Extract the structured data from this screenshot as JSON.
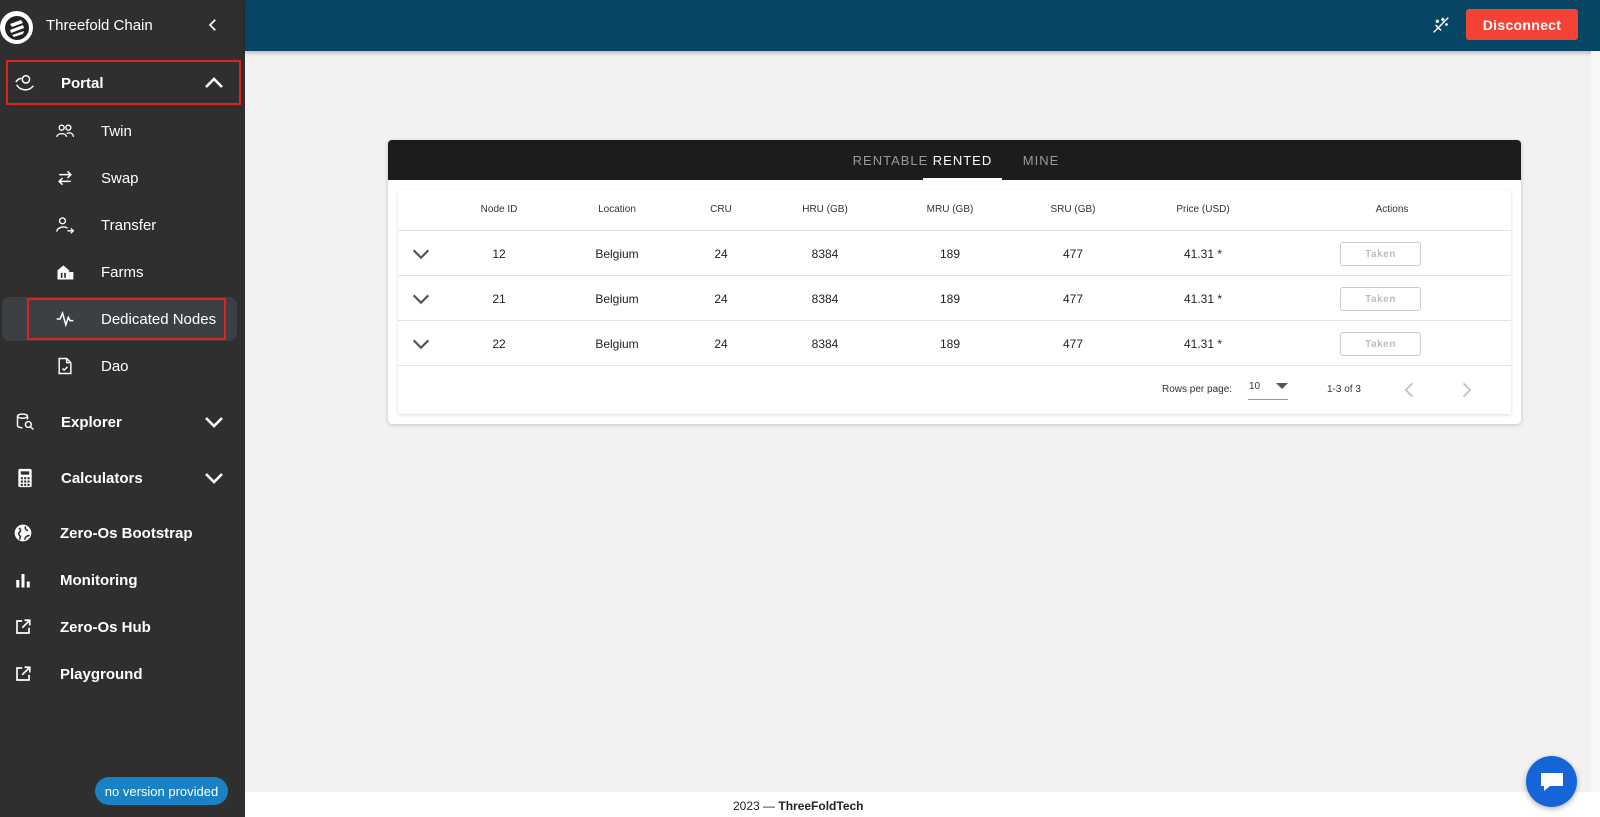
{
  "brand": {
    "title": "Threefold Chain"
  },
  "sidebar": {
    "portal": {
      "label": "Portal"
    },
    "portal_items": [
      {
        "label": "Twin",
        "icon": "twin-icon"
      },
      {
        "label": "Swap",
        "icon": "swap-icon"
      },
      {
        "label": "Transfer",
        "icon": "transfer-icon"
      },
      {
        "label": "Farms",
        "icon": "farms-icon"
      },
      {
        "label": "Dedicated Nodes",
        "icon": "dedicated-nodes-icon"
      },
      {
        "label": "Dao",
        "icon": "dao-icon"
      }
    ],
    "groups": [
      {
        "label": "Explorer",
        "icon": "explorer-icon"
      },
      {
        "label": "Calculators",
        "icon": "calculator-icon"
      }
    ],
    "links": [
      {
        "label": "Zero-Os Bootstrap",
        "icon": "globe-icon"
      },
      {
        "label": "Monitoring",
        "icon": "bar-chart-icon"
      },
      {
        "label": "Zero-Os Hub",
        "icon": "external-link-icon"
      },
      {
        "label": "Playground",
        "icon": "external-link-icon"
      }
    ],
    "version": "no version provided"
  },
  "header": {
    "disconnect_label": "Disconnect"
  },
  "tabs": [
    {
      "label": "RENTABLE",
      "active": false
    },
    {
      "label": "RENTED",
      "active": true
    },
    {
      "label": "MINE",
      "active": false
    }
  ],
  "table": {
    "headers": [
      "Node ID",
      "Location",
      "CRU",
      "HRU (GB)",
      "MRU (GB)",
      "SRU (GB)",
      "Price (USD)",
      "Actions"
    ],
    "rows": [
      {
        "node_id": "12",
        "location": "Belgium",
        "cru": "24",
        "hru": "8384",
        "mru": "189",
        "sru": "477",
        "price": "41.31 *",
        "action": "Taken"
      },
      {
        "node_id": "21",
        "location": "Belgium",
        "cru": "24",
        "hru": "8384",
        "mru": "189",
        "sru": "477",
        "price": "41.31 *",
        "action": "Taken"
      },
      {
        "node_id": "22",
        "location": "Belgium",
        "cru": "24",
        "hru": "8384",
        "mru": "189",
        "sru": "477",
        "price": "41.31 *",
        "action": "Taken"
      }
    ],
    "rows_per_page_label": "Rows per page:",
    "rows_per_page_value": "10",
    "page_info": "1-3 of 3"
  },
  "footer": {
    "year": "2023 —",
    "company": "ThreeFoldTech"
  },
  "colors": {
    "sidebar_bg": "#2f2f2f",
    "header_bg": "#064564",
    "disconnect": "#f44336",
    "highlight_border": "#e32020",
    "badge": "#1982c4",
    "chat": "#1565d8"
  }
}
